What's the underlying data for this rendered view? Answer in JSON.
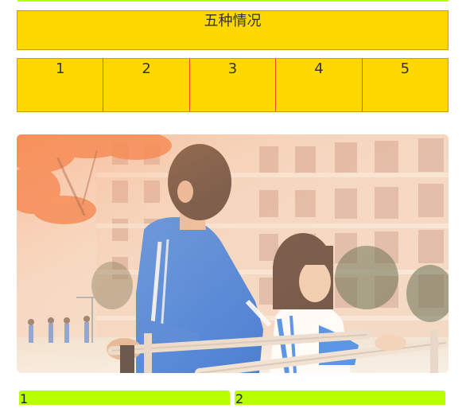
{
  "header": {
    "title": "五种情况"
  },
  "cells": [
    "1",
    "2",
    "3",
    "4",
    "5"
  ],
  "photo": {
    "alt": "school photo"
  },
  "bottom": [
    "1",
    "2"
  ],
  "colors": {
    "yellow": "#ffd800",
    "border": "#d49b00",
    "divider": "#ef4a2a",
    "lime": "#b8ff00"
  }
}
